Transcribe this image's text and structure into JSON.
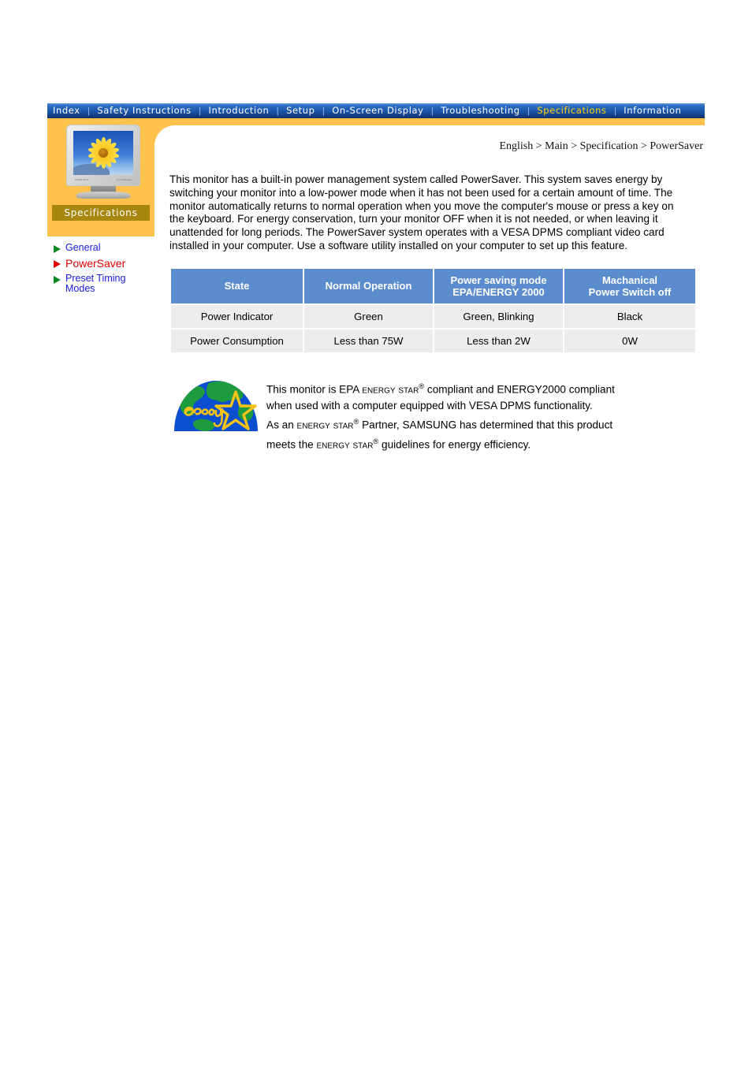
{
  "nav": {
    "items": [
      {
        "label": "Index",
        "active": false
      },
      {
        "label": "Safety Instructions",
        "active": false
      },
      {
        "label": "Introduction",
        "active": false
      },
      {
        "label": "Setup",
        "active": false
      },
      {
        "label": "On-Screen Display",
        "active": false
      },
      {
        "label": "Troubleshooting",
        "active": false
      },
      {
        "label": "Specifications",
        "active": true
      },
      {
        "label": "Information",
        "active": false
      }
    ],
    "separator": "|"
  },
  "sidebar": {
    "tab_label": "Specifications",
    "monitor_brand": "SAMSUNG",
    "monitor_brand_right": "SyncMaster",
    "items": [
      {
        "label": "General",
        "active": false
      },
      {
        "label": "PowerSaver",
        "active": true
      },
      {
        "label": "Preset Timing Modes",
        "active": false
      }
    ]
  },
  "breadcrumb": "English > Main > Specification > PowerSaver",
  "main": {
    "paragraph": "This monitor has a built-in power management system called PowerSaver. This system saves energy by switching your monitor into a low-power mode when it has not been used for a certain amount of time. The monitor automatically returns to normal operation when you move the computer's mouse or press a key on the keyboard. For energy conservation, turn your monitor OFF when it is not needed, or when leaving it unattended for long periods. The PowerSaver system operates with a VESA DPMS compliant video card installed in your computer. Use a software utility installed on your computer to set up this feature."
  },
  "table": {
    "headers": [
      {
        "line1": "State",
        "line2": ""
      },
      {
        "line1": "Normal Operation",
        "line2": ""
      },
      {
        "line1": "Power saving mode",
        "line2": "EPA/ENERGY 2000"
      },
      {
        "line1": "Machanical",
        "line2": "Power Switch off"
      }
    ],
    "rows": [
      {
        "cells": [
          "Power Indicator",
          "Green",
          "Green, Blinking",
          "Black"
        ]
      },
      {
        "cells": [
          "Power Consumption",
          "Less than 75W",
          "Less than 2W",
          "0W"
        ]
      }
    ]
  },
  "energy_star": {
    "logo_word": "energy",
    "line1_a": "This monitor is EPA ",
    "line1_energy": "Energy",
    "line1_star": "Star",
    "line1_b": " compliant and ENERGY2000 compliant",
    "line2": "when used with a computer equipped with VESA DPMS functionality.",
    "line3_a": "As an ",
    "line3_energy": "Energy",
    "line3_star": "Star",
    "line3_b": " Partner, SAMSUNG has determined that this product",
    "line4_a": "meets the ",
    "line4_energy": "Energy",
    "line4_star": "Star",
    "line4_b": " guidelines for energy efficiency.",
    "registered_mark": "®"
  },
  "colors": {
    "nav_gradient_top": "#6a9fe0",
    "nav_gradient_bottom": "#12306a",
    "nav_active": "#ffd400",
    "orange_band": "#ffc34d",
    "spec_tab": "#a8870e",
    "table_header": "#5b8ccd",
    "table_cell": "#ededed",
    "link_blue": "#1a1ae0",
    "link_active_red": "#e40000",
    "triangle_green": "#0a8a22",
    "triangle_red": "#e00000"
  }
}
